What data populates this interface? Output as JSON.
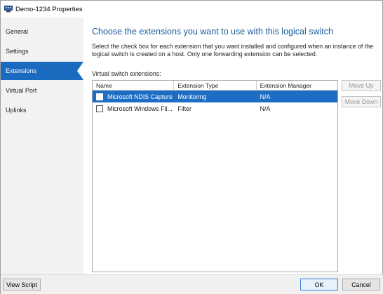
{
  "window": {
    "title": "Demo-1234 Properties",
    "icon": "virtual-switch-icon"
  },
  "sidebar": {
    "items": [
      {
        "label": "General"
      },
      {
        "label": "Settings"
      },
      {
        "label": "Extensions",
        "active": true
      },
      {
        "label": "Virtual Port"
      },
      {
        "label": "Uplinks"
      }
    ]
  },
  "main": {
    "heading": "Choose the extensions you want to use with this logical switch",
    "description": "Select the check box for each extension that you want installed and configured when an instance of the logical switch is created on a host. Only one forwarding extension can be selected.",
    "list_label": "Virtual switch extensions:",
    "columns": [
      "Name",
      "Extension Type",
      "Extension Manager"
    ],
    "rows": [
      {
        "name": "Microsoft NDIS Capture",
        "type": "Monitoring",
        "manager": "N/A",
        "checked": false,
        "selected": true
      },
      {
        "name": "Microsoft Windows Fil...",
        "type": "Filter",
        "manager": "N/A",
        "checked": false,
        "selected": false
      }
    ],
    "move_up_label": "Move Up",
    "move_down_label": "Move Down"
  },
  "footer": {
    "view_script_label": "View Script",
    "ok_label": "OK",
    "cancel_label": "Cancel"
  },
  "colors": {
    "accent": "#1a6bbf",
    "selection": "#1e6dc4",
    "heading": "#1a5a9a"
  }
}
